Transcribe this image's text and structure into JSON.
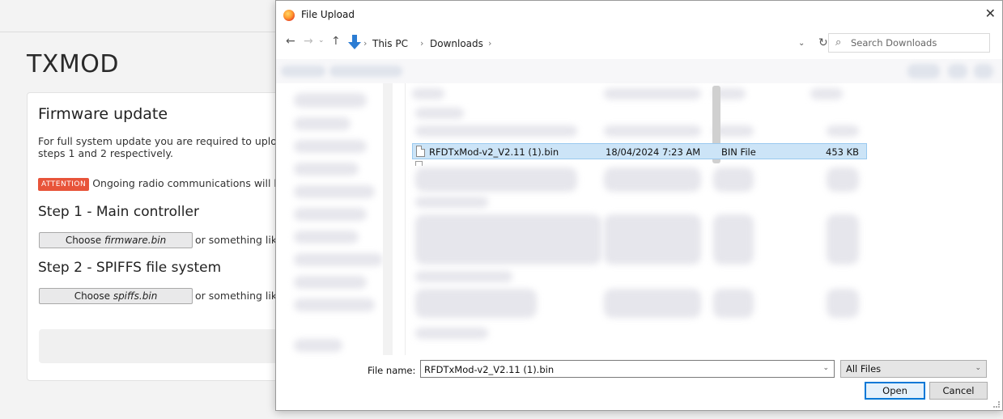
{
  "page": {
    "title": "TXMOD",
    "firmware_card": {
      "heading": "Firmware update",
      "description_line1": "For full system update you are required to upload",
      "description_line2": "steps 1 and 2 respectively.",
      "attention_badge": "ATTENTION",
      "attention_text": "Ongoing radio communications will be",
      "step1_title": "Step 1 - Main controller",
      "step1_button_prefix": "Choose ",
      "step1_button_file": "firmware.bin",
      "step1_hint": "or something like",
      "step2_title": "Step 2 - SPIFFS file system",
      "step2_button_prefix": "Choose ",
      "step2_button_file": "spiffs.bin",
      "step2_hint": "or something like"
    }
  },
  "dialog": {
    "title": "File Upload",
    "close_glyph": "✕",
    "nav": {
      "back_glyph": "←",
      "forward_glyph": "→",
      "recent_glyph": "⌄",
      "up_glyph": "↑",
      "breadcrumbs": [
        "This PC",
        "Downloads"
      ],
      "separator": "›",
      "refresh_glyph": "↻",
      "dropdown_glyph": "⌄"
    },
    "search": {
      "placeholder": "Search Downloads",
      "icon_glyph": "⌕"
    },
    "selected_file": {
      "name": "RFDTxMod-v2_V2.11 (1).bin",
      "date_modified": "18/04/2024 7:23 AM",
      "type": "BIN File",
      "size": "453 KB"
    },
    "footer": {
      "file_name_label": "File name:",
      "file_name_value": "RFDTxMod-v2_V2.11 (1).bin",
      "file_type_value": "All Files",
      "chevron_glyph": "⌄",
      "open_label": "Open",
      "cancel_label": "Cancel"
    }
  },
  "colors": {
    "accent": "#0078d7",
    "selection": "#cce4f7",
    "attention": "#e8543a"
  }
}
